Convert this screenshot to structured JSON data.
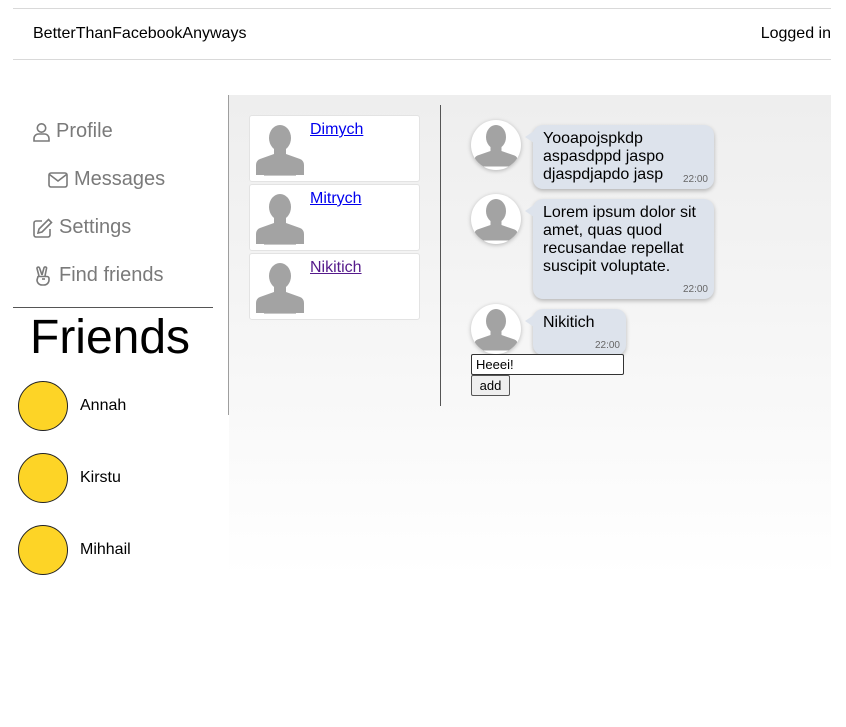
{
  "header": {
    "brand": "BetterThanFacebookAnyways",
    "login_status": "Logged in"
  },
  "nav": {
    "items": [
      {
        "label": "Profile",
        "icon": "person-icon"
      },
      {
        "label": "Messages",
        "icon": "envelope-icon"
      },
      {
        "label": "Settings",
        "icon": "edit-icon"
      },
      {
        "label": "Find friends",
        "icon": "peace-hand-icon"
      }
    ]
  },
  "friends": {
    "title": "Friends",
    "items": [
      {
        "name": "Annah"
      },
      {
        "name": "Kirstu"
      },
      {
        "name": "Mihhail"
      }
    ],
    "avatar_color": "#fdd426"
  },
  "dialogs": [
    {
      "name": "Dimych"
    },
    {
      "name": "Mitrych"
    },
    {
      "name": "Nikitich"
    }
  ],
  "messages": [
    {
      "text": "Yooapojspkdp aspasdppd jaspo djaspdjapdo jasp",
      "time": "22:00"
    },
    {
      "text": "Lorem ipsum dolor sit amet, quas quod recusandae repellat suscipit voluptate.",
      "time": "22:00"
    },
    {
      "text": "Nikitich",
      "time": "22:00"
    }
  ],
  "composer": {
    "value": "Heeei!",
    "button_label": "add"
  },
  "colors": {
    "bubble": "#dde3ec",
    "link": "#0000ee",
    "visited_link": "#551a8b"
  }
}
